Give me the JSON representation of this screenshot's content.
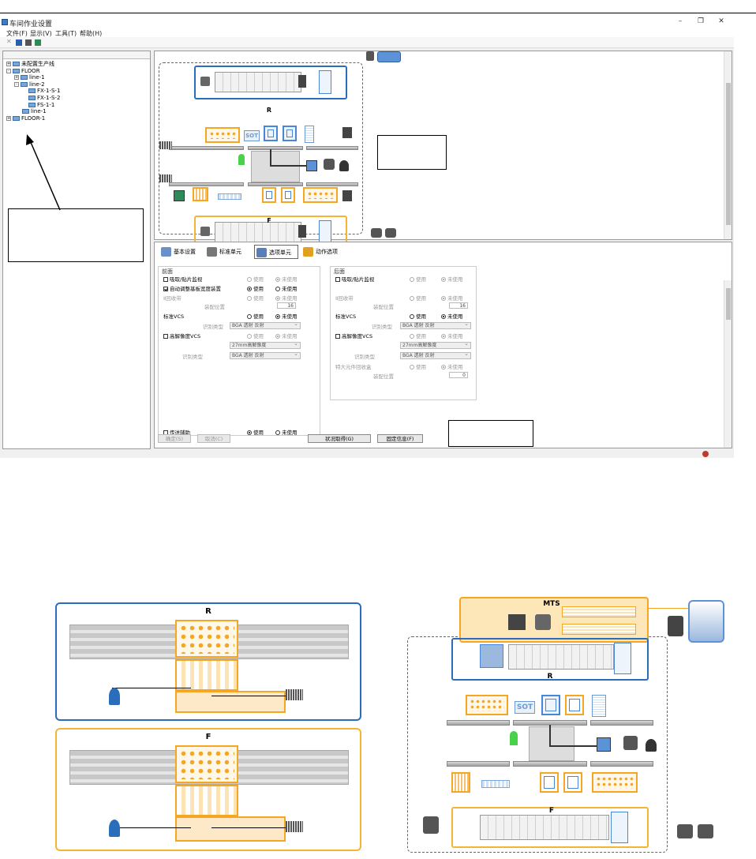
{
  "window": {
    "title": "车间作业设置",
    "controls": {
      "minimize": "–",
      "restore": "❐",
      "close": "✕"
    }
  },
  "menu": [
    "文件(F)",
    "显示(V)",
    "工具(T)",
    "帮助(H)"
  ],
  "tree": {
    "items": [
      {
        "label": "未配置生产线",
        "indent": 0,
        "expander": "+"
      },
      {
        "label": "FLOOR",
        "indent": 0,
        "expander": "-"
      },
      {
        "label": "line-1",
        "indent": 1,
        "expander": "+"
      },
      {
        "label": "line-2",
        "indent": 1,
        "expander": "-"
      },
      {
        "label": "FX-1-S-1",
        "indent": 2,
        "expander": ""
      },
      {
        "label": "FX-1-S-2",
        "indent": 2,
        "expander": ""
      },
      {
        "label": "FS-1-1",
        "indent": 2,
        "expander": ""
      },
      {
        "label": "line-1",
        "indent": 1,
        "expander": ""
      },
      {
        "label": "FLOOR-1",
        "indent": 0,
        "expander": "+"
      }
    ]
  },
  "diagram": {
    "rear_label": "R",
    "front_label": "F",
    "sot_label": "SOT"
  },
  "tabs": [
    {
      "label": "基本设置",
      "active": false
    },
    {
      "label": "标准单元",
      "active": false
    },
    {
      "label": "选项单元",
      "active": true
    },
    {
      "label": "动作选项",
      "active": false
    }
  ],
  "options": {
    "front": {
      "title": "前面",
      "rows": [
        {
          "label": "吸取/贴片监视",
          "use": "使用",
          "nouse": "未使用"
        },
        {
          "label": "自动调整基板宽度装置",
          "use": "使用",
          "nouse": "未使用"
        },
        {
          "label": "Ⅱ回收带",
          "use": "使用",
          "nouse": "未使用"
        },
        {
          "label": "装配位置",
          "value": "16"
        },
        {
          "label": "标准VCS",
          "use": "使用",
          "nouse": "未使用"
        },
        {
          "label": "识别类型",
          "value": "BGA 透射 反射"
        },
        {
          "label": "高解像度VCS",
          "use": "使用",
          "nouse": "未使用"
        },
        {
          "label": "",
          "value": "27mm高解像度"
        },
        {
          "label": "识别类型",
          "value": "BGA 透射 反射"
        },
        {
          "label": "传送辅助",
          "use": "使用",
          "nouse": "未使用"
        }
      ]
    },
    "rear": {
      "title": "后面",
      "rows": [
        {
          "label": "吸取/贴片监视",
          "use": "使用",
          "nouse": "未使用"
        },
        {
          "label": "Ⅱ回收带",
          "use": "使用",
          "nouse": "未使用"
        },
        {
          "label": "装配位置",
          "value": "16"
        },
        {
          "label": "标准VCS",
          "use": "使用",
          "nouse": "未使用"
        },
        {
          "label": "识别类型",
          "value": "BGA 透射 反射"
        },
        {
          "label": "高解像度VCS",
          "use": "使用",
          "nouse": "未使用"
        },
        {
          "label": "",
          "value": "27mm高解像度"
        },
        {
          "label": "识别类型",
          "value": "BGA 透射 反射"
        },
        {
          "label": "特大元件回收盒",
          "use": "使用",
          "nouse": "未使用"
        },
        {
          "label": "装配位置",
          "value": "0"
        }
      ]
    }
  },
  "buttons": {
    "confirm": "确定(S)",
    "cancel": "取消(C)",
    "status": "状况取得(G)",
    "fixed_info": "固定信息(F)"
  },
  "lower_figures": {
    "left_rear_label": "R",
    "left_front_label": "F",
    "right_mts_label": "MTS",
    "right_rear_label": "R",
    "right_front_label": "F",
    "right_sot_label": "SOT"
  },
  "colors": {
    "rear_frame": "#2a6ebb",
    "front_frame": "#f5b431",
    "feeder_orange": "#f5a623",
    "tray_blue": "#4a86d6"
  }
}
